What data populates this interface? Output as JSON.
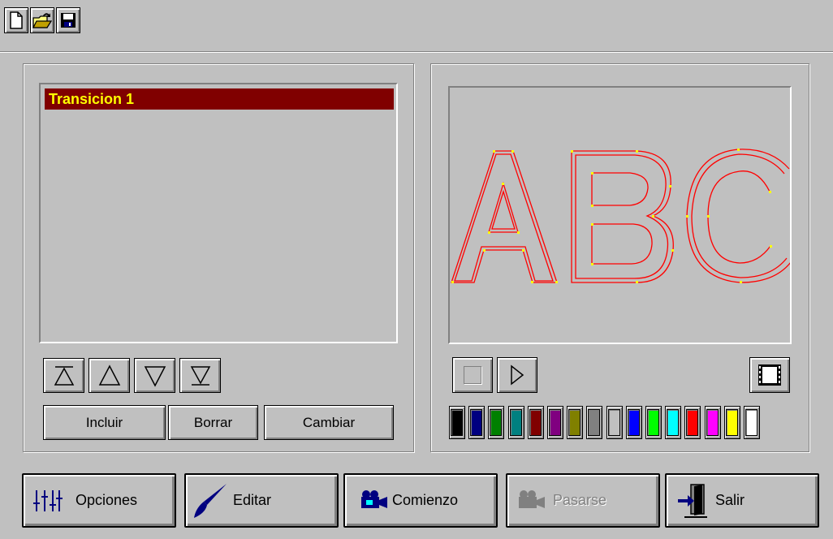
{
  "toolbar": {
    "new_icon": "new-document-icon",
    "open_icon": "open-folder-icon",
    "save_icon": "floppy-disk-icon"
  },
  "left_panel": {
    "list_items": [
      "Transicion 1"
    ],
    "selected_index": 0,
    "arrows": [
      "move-top-icon",
      "move-up-icon",
      "move-down-icon",
      "move-bottom-icon"
    ],
    "buttons": {
      "include": "Incluir",
      "delete": "Borrar",
      "change": "Cambiar"
    }
  },
  "right_panel": {
    "preview_text": "ABC",
    "outline_color": "#ff0000",
    "node_color": "#ffff00",
    "palette": [
      "#000000",
      "#000080",
      "#008000",
      "#008080",
      "#800000",
      "#800080",
      "#808000",
      "#808080",
      "#c0c0c0",
      "#0000ff",
      "#00ff00",
      "#00ffff",
      "#ff0000",
      "#ff00ff",
      "#ffff00",
      "#ffffff"
    ]
  },
  "bottom_buttons": {
    "options": "Opciones",
    "edit": "Editar",
    "start": "Comienzo",
    "skip": "Pasarse",
    "exit": "Salir"
  }
}
